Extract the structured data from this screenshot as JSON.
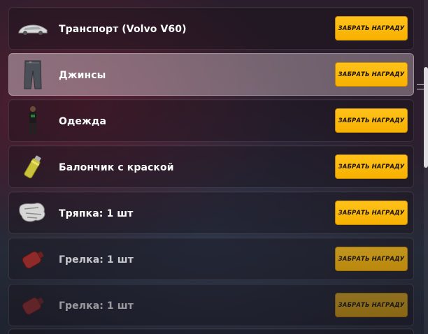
{
  "rewards": {
    "button_label": "ЗАБРАТЬ НАГРАДУ",
    "items": [
      {
        "label": "Транспорт (Volvo V60)",
        "icon": "car-icon"
      },
      {
        "label": "Джинсы",
        "icon": "jeans-icon"
      },
      {
        "label": "Одежда",
        "icon": "outfit-icon"
      },
      {
        "label": "Балончик с краской",
        "icon": "spray-can-icon"
      },
      {
        "label": "Тряпка: 1 шт",
        "icon": "rag-icon"
      },
      {
        "label": "Грелка: 1 шт",
        "icon": "hot-water-bottle-icon"
      },
      {
        "label": "Грелка: 1 шт",
        "icon": "hot-water-bottle-icon"
      }
    ]
  },
  "colors": {
    "button": "#f7b100",
    "row_active": "#c8b4be"
  }
}
